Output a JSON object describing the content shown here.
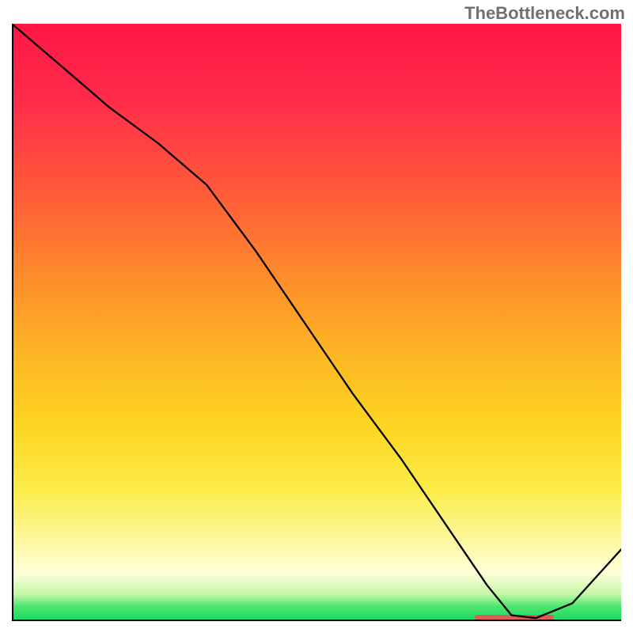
{
  "watermark": "TheBottleneck.com",
  "chart_data": {
    "type": "line",
    "title": "",
    "xlabel": "",
    "ylabel": "",
    "xlim": [
      0,
      100
    ],
    "ylim": [
      0,
      100
    ],
    "x": [
      0,
      8,
      16,
      24,
      32,
      40,
      48,
      56,
      64,
      72,
      78,
      82,
      86,
      92,
      100
    ],
    "values": [
      100,
      93,
      86,
      80,
      73,
      62,
      50,
      38,
      27,
      15,
      6,
      1,
      0.5,
      3,
      12
    ],
    "optimal_range_x": [
      76,
      89
    ],
    "gradient_stops": [
      {
        "pos": 0.0,
        "color": "#ff1744"
      },
      {
        "pos": 0.12,
        "color": "#ff2a4a"
      },
      {
        "pos": 0.28,
        "color": "#ff5a3a"
      },
      {
        "pos": 0.42,
        "color": "#fe8b2b"
      },
      {
        "pos": 0.56,
        "color": "#fdb824"
      },
      {
        "pos": 0.68,
        "color": "#fcd722"
      },
      {
        "pos": 0.78,
        "color": "#fbec4a"
      },
      {
        "pos": 0.86,
        "color": "#fdf79a"
      },
      {
        "pos": 0.92,
        "color": "#feffda"
      },
      {
        "pos": 0.955,
        "color": "#c3f7a7"
      },
      {
        "pos": 0.975,
        "color": "#4de66e"
      },
      {
        "pos": 1.0,
        "color": "#17d964"
      }
    ]
  }
}
